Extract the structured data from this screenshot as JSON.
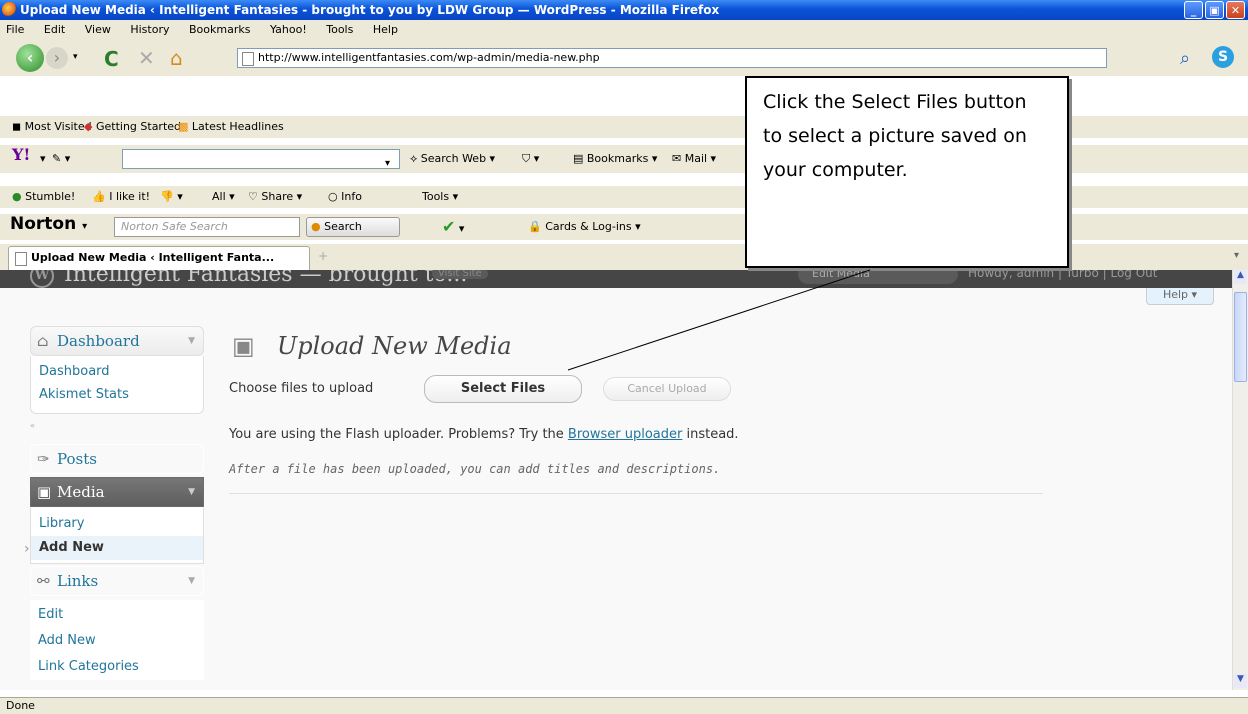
{
  "window": {
    "title": "Upload New Media ‹ Intelligent Fantasies - brought to you by LDW Group — WordPress - Mozilla Firefox"
  },
  "menubar": [
    "File",
    "Edit",
    "View",
    "History",
    "Bookmarks",
    "Yahoo!",
    "Tools",
    "Help"
  ],
  "navbar": {
    "url": "http://www.intelligentfantasies.com/wp-admin/media-new.php"
  },
  "bookmarks": [
    "Most Visited",
    "Getting Started",
    "Latest Headlines"
  ],
  "yahoo_toolbar": {
    "search_web": "Search Web",
    "bookmarks": "Bookmarks",
    "mail": "Mail"
  },
  "stumble_toolbar": {
    "stumble": "Stumble!",
    "like": "I like it!",
    "all": "All",
    "share": "Share",
    "info": "Info",
    "tools": "Tools"
  },
  "norton_toolbar": {
    "brand": "Norton",
    "search_placeholder": "Norton Safe Search",
    "search_button": "Search",
    "cards": "Cards & Log-ins"
  },
  "tab": {
    "label": "Upload New Media ‹ Intelligent Fanta..."
  },
  "wp_header": {
    "site_title": "Intelligent Fantasies — brought to...",
    "visit_site": "Visit Site",
    "favorite": "Edit Media",
    "user_links": "Howdy, admin | Turbo | Log Out"
  },
  "sidebar": {
    "dashboard": {
      "label": "Dashboard",
      "items": [
        "Dashboard",
        "Akismet Stats"
      ]
    },
    "posts": {
      "label": "Posts"
    },
    "media": {
      "label": "Media",
      "items": [
        "Library",
        "Add New"
      ]
    },
    "links": {
      "label": "Links",
      "items": [
        "Edit",
        "Add New",
        "Link Categories"
      ]
    }
  },
  "main": {
    "help": "Help",
    "page_title": "Upload New Media",
    "choose_label": "Choose files to upload",
    "select_files": "Select Files",
    "cancel_upload": "Cancel Upload",
    "flash_text_before": "You are using the Flash uploader. Problems? Try the ",
    "flash_link": "Browser uploader",
    "flash_text_after": " instead.",
    "after_upload_note": "After a file has been uploaded, you can add titles and descriptions."
  },
  "callout": {
    "text": "Click the Select Files button to select a picture saved on your computer."
  },
  "status": {
    "text": "Done"
  }
}
